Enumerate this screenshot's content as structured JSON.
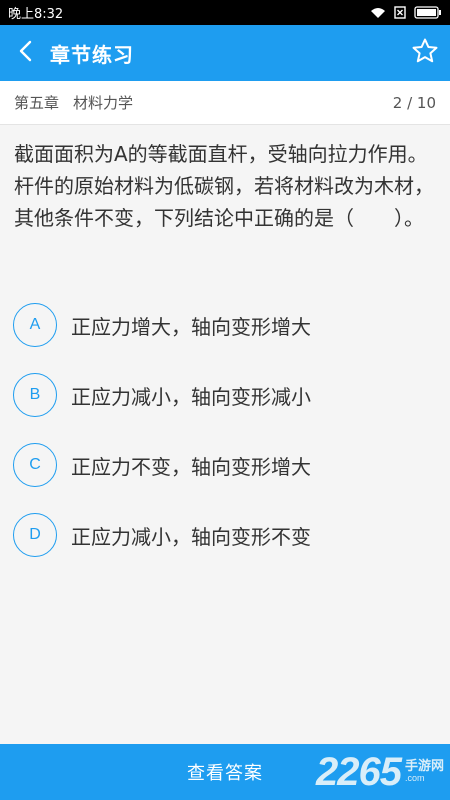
{
  "status_bar": {
    "time": "晚上8:32",
    "icons": [
      "wifi-icon",
      "sim-off-icon",
      "battery-icon"
    ]
  },
  "app_bar": {
    "title": "章节练习",
    "back_icon": "chevron-left-icon",
    "favorite_icon": "star-outline-icon"
  },
  "chapter": {
    "name": "第五章",
    "subject": "材料力学",
    "progress": "2 / 10"
  },
  "question": {
    "text": "截面面积为A的等截面直杆，受轴向拉力作用。杆件的原始材料为低碳钢，若将材料改为木材，其他条件不变，下列结论中正确的是（　　）。"
  },
  "options": [
    {
      "letter": "A",
      "text": "正应力增大，轴向变形增大"
    },
    {
      "letter": "B",
      "text": "正应力减小，轴向变形减小"
    },
    {
      "letter": "C",
      "text": "正应力不变，轴向变形增大"
    },
    {
      "letter": "D",
      "text": "正应力减小，轴向变形不变"
    }
  ],
  "bottom_bar": {
    "label": "查看答案"
  },
  "watermark": {
    "number": "2265",
    "cn": "手游网",
    "en": ".com"
  },
  "colors": {
    "accent": "#1e9df0",
    "background": "#f5f5f5",
    "text": "#333333"
  }
}
